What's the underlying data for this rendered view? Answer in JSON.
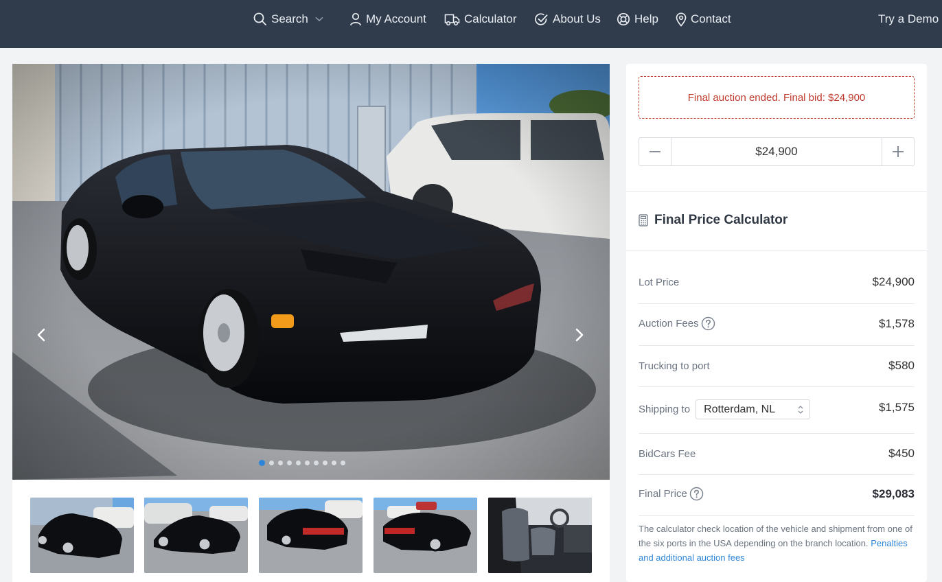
{
  "nav": {
    "search": "Search",
    "account": "My Account",
    "calculator": "Calculator",
    "about": "About Us",
    "help": "Help",
    "contact": "Contact",
    "demo": "Try a Demo"
  },
  "gallery": {
    "dot_count": 10,
    "active_dot": 0,
    "thumbnails": [
      "front-left",
      "front-left-lot",
      "rear-left",
      "rear-right",
      "interior"
    ]
  },
  "bid": {
    "alert": "Final auction ended. Final bid: $24,900",
    "amount": "$24,900",
    "minus_icon": "minus-icon",
    "plus_icon": "plus-icon"
  },
  "calculator": {
    "title": "Final Price Calculator",
    "lot_label": "Lot Price",
    "lot_value": "$24,900",
    "fees_label": "Auction Fees",
    "fees_value": "$1,578",
    "trucking_label": "Trucking to port",
    "trucking_value": "$580",
    "shipping_label": "Shipping to",
    "shipping_port": "Rotterdam, NL",
    "shipping_value": "$1,575",
    "bidcars_label": "BidCars Fee",
    "bidcars_value": "$450",
    "final_label": "Final Price",
    "final_value": "$29,083",
    "note": "The calculator check location of the vehicle and shipment from one of the six ports in the USA depending on the branch location. ",
    "note_link": "Penalties and additional auction fees"
  },
  "colors": {
    "topbar": "#303c4c",
    "accent": "#2f86d8",
    "alert": "#c0392b"
  }
}
